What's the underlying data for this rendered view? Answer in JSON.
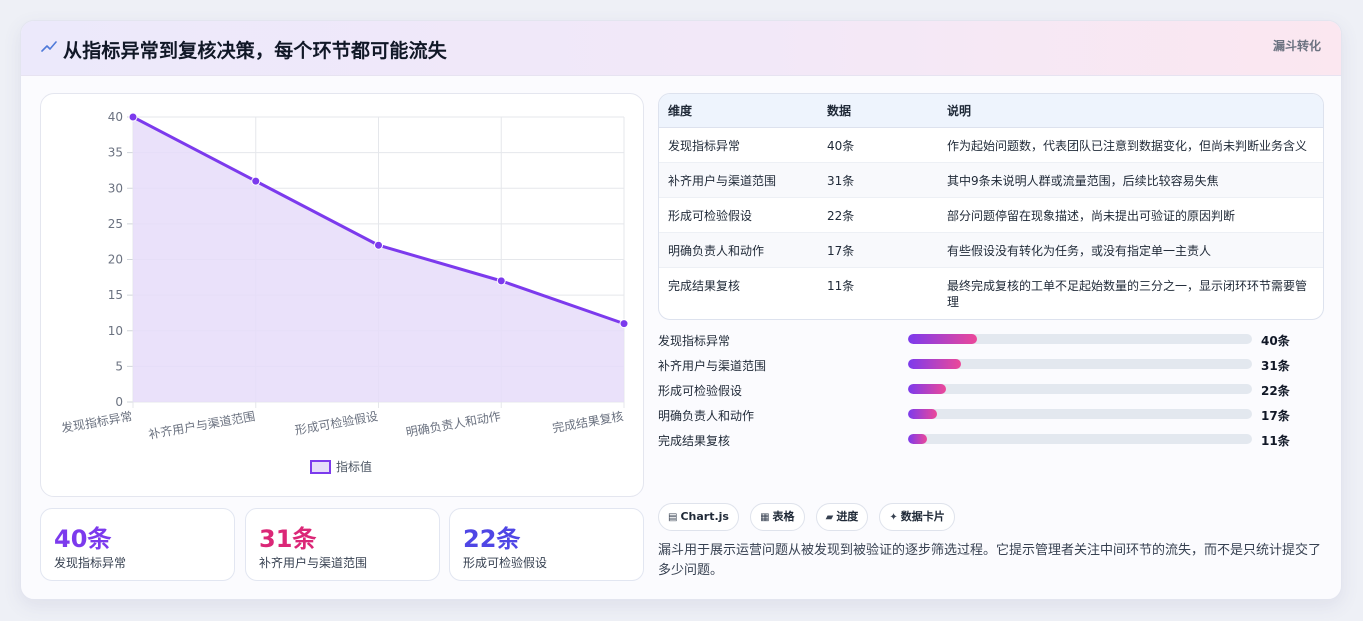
{
  "header": {
    "icon": "trend-line-icon",
    "title": "从指标异常到复核决策，每个环节都可能流失",
    "tag": "漏斗转化"
  },
  "colors": {
    "accent_purple": "#7c3aed",
    "accent_pink": "#db2777",
    "accent_indigo": "#4f46e5",
    "area_fill": "#e6dcf9"
  },
  "chart_data": {
    "type": "line",
    "categories": [
      "发现指标异常",
      "补齐用户与渠道范围",
      "形成可检验假设",
      "明确负责人和动作",
      "完成结果复核"
    ],
    "series": [
      {
        "name": "指标值",
        "values": [
          40,
          31,
          22,
          17,
          11
        ]
      }
    ],
    "yticks": [
      "0",
      "5",
      "10",
      "15",
      "20",
      "25",
      "30",
      "35",
      "40"
    ],
    "ylim": [
      0,
      40
    ],
    "grid": true,
    "fill": true,
    "legend_position": "bottom"
  },
  "stats": [
    {
      "value": "40条",
      "label": "发现指标异常",
      "color": "#7c3aed"
    },
    {
      "value": "31条",
      "label": "补齐用户与渠道范围",
      "color": "#db2777"
    },
    {
      "value": "22条",
      "label": "形成可检验假设",
      "color": "#4f46e5"
    }
  ],
  "table": {
    "headers": [
      "维度",
      "数据",
      "说明"
    ],
    "rows": [
      [
        "发现指标异常",
        "40条",
        "作为起始问题数，代表团队已注意到数据变化，但尚未判断业务含义"
      ],
      [
        "补齐用户与渠道范围",
        "31条",
        "其中9条未说明人群或流量范围，后续比较容易失焦"
      ],
      [
        "形成可检验假设",
        "22条",
        "部分问题停留在现象描述，尚未提出可验证的原因判断"
      ],
      [
        "明确负责人和动作",
        "17条",
        "有些假设没有转化为任务，或没有指定单一主责人"
      ],
      [
        "完成结果复核",
        "11条",
        "最终完成复核的工单不足起始数量的三分之一，显示闭环环节需要管理"
      ]
    ]
  },
  "progress": [
    {
      "label": "发现指标异常",
      "value": "40条",
      "fraction": 0.2
    },
    {
      "label": "补齐用户与渠道范围",
      "value": "31条",
      "fraction": 0.155
    },
    {
      "label": "形成可检验假设",
      "value": "22条",
      "fraction": 0.11
    },
    {
      "label": "明确负责人和动作",
      "value": "17条",
      "fraction": 0.085
    },
    {
      "label": "完成结果复核",
      "value": "11条",
      "fraction": 0.055
    }
  ],
  "tags": [
    {
      "icon": "chart-icon",
      "label": "Chart.js"
    },
    {
      "icon": "table-icon",
      "label": "表格"
    },
    {
      "icon": "progress-icon",
      "label": "进度"
    },
    {
      "icon": "sparkle-icon",
      "label": "数据卡片"
    }
  ],
  "summary": "漏斗用于展示运营问题从被发现到被验证的逐步筛选过程。它提示管理者关注中间环节的流失，而不是只统计提交了多少问题。"
}
